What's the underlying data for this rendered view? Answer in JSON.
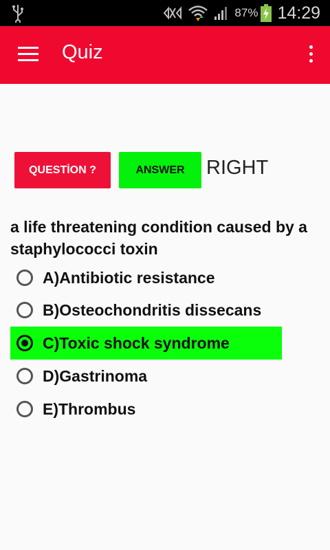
{
  "status_bar": {
    "battery_percent": "87%",
    "time": "14:29",
    "icons": [
      "usb-icon",
      "signal-blocked-icon",
      "wifi-icon",
      "cell-signal-icon",
      "battery-charging-icon"
    ]
  },
  "app_bar": {
    "title": "Quiz",
    "menu_icon": "hamburger-menu-icon",
    "overflow_icon": "more-vert-icon"
  },
  "controls": {
    "question_button": "QUESTİON ?",
    "answer_button": "ANSWER",
    "result": "RIGHT"
  },
  "question": {
    "text": "a life threatening condition caused by a staphylococci toxin",
    "options": [
      {
        "label": "A)Antibiotic resistance",
        "selected": false
      },
      {
        "label": "B)Osteochondritis dissecans",
        "selected": false
      },
      {
        "label": "C)Toxic shock syndrome",
        "selected": true
      },
      {
        "label": "D)Gastrinoma",
        "selected": false
      },
      {
        "label": "E)Thrombus",
        "selected": false
      }
    ]
  },
  "colors": {
    "app_bar": "#f0092f",
    "question_button": "#ee1137",
    "answer_button": "#04f10b",
    "selected_highlight": "#0aff0a"
  }
}
